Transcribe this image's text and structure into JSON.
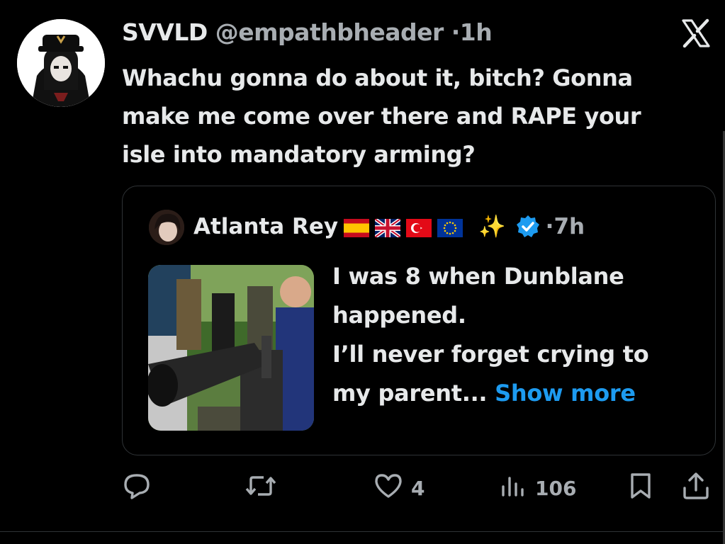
{
  "tweet": {
    "display_name": "SVVLD",
    "handle": "@empathbheader",
    "separator": "·",
    "time": "1h",
    "text_lines": [
      "Whachu gonna do about it, bitch? Gonna",
      "make me come over there and RAPE your",
      "isle into mandatory arming?"
    ]
  },
  "quote": {
    "display_name": "Atlanta Rey",
    "flags": [
      "spain-flag-icon",
      "uk-flag-icon",
      "turkey-flag-icon",
      "eu-flag-icon"
    ],
    "sparkle": "✨",
    "separator": "·",
    "time": "7h",
    "text_lines": [
      "I was 8 when Dunblane",
      "happened.",
      "I’ll never forget crying to",
      "my parent"
    ],
    "ellipsis": "...",
    "show_more": "Show more"
  },
  "actions": {
    "reply_count": "",
    "retweet_count": "",
    "like_count": "4",
    "views_count": "106"
  },
  "colors": {
    "background": "#000000",
    "text": "#e7e9ea",
    "muted": "#a8adb2",
    "accent": "#1d9bf0",
    "border": "#2f3336"
  }
}
